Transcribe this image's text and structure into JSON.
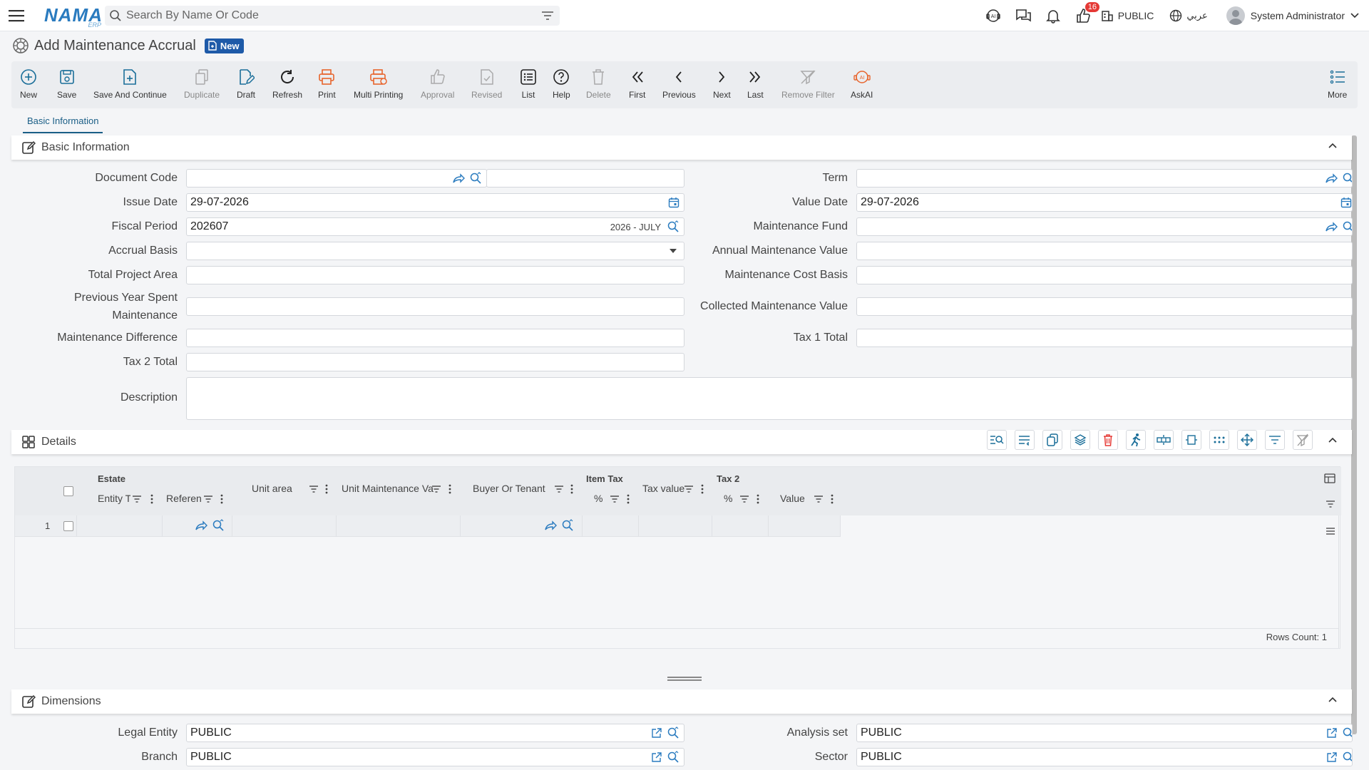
{
  "topbar": {
    "logo_main": "NAMA",
    "logo_sub": "ERP",
    "search_placeholder": "Search By Name Or Code",
    "notif_count": "16",
    "company": "PUBLIC",
    "language": "عربي",
    "user_name": "System Administrator"
  },
  "page": {
    "title": "Add Maintenance Accrual",
    "badge": "New"
  },
  "toolbar": {
    "new": "New",
    "save": "Save",
    "save_continue": "Save And Continue",
    "duplicate": "Duplicate",
    "draft": "Draft",
    "refresh": "Refresh",
    "print": "Print",
    "multi_printing": "Multi Printing",
    "approval": "Approval",
    "revised": "Revised",
    "list": "List",
    "help": "Help",
    "delete": "Delete",
    "first": "First",
    "previous": "Previous",
    "next": "Next",
    "last": "Last",
    "remove_filter": "Remove Filter",
    "askai": "AskAI",
    "more": "More"
  },
  "tabs": {
    "basic": "Basic Information"
  },
  "basic": {
    "title": "Basic Information",
    "labels": {
      "document_code": "Document Code",
      "issue_date": "Issue Date",
      "fiscal_period": "Fiscal Period",
      "accrual_basis": "Accrual Basis",
      "total_project_area": "Total Project Area",
      "prev_year_line1": "Previous Year Spent",
      "prev_year_line2": "Maintenance",
      "maintenance_difference": "Maintenance Difference",
      "tax2_total": "Tax 2 Total",
      "description": "Description",
      "term": "Term",
      "value_date": "Value Date",
      "maintenance_fund": "Maintenance Fund",
      "annual_maintenance_value": "Annual Maintenance Value",
      "maintenance_cost_basis": "Maintenance Cost Basis",
      "collected_maintenance_value": "Collected Maintenance Value",
      "tax1_total": "Tax 1 Total"
    },
    "values": {
      "issue_date": "29-07-2026",
      "value_date": "29-07-2026",
      "fiscal_period": "202607",
      "fiscal_period_suffix": "2026 - JULY"
    }
  },
  "details": {
    "title": "Details",
    "headers": {
      "estate": "Estate",
      "entity_type": "Entity Ty",
      "reference": "Referen",
      "unit_area": "Unit area",
      "unit_maintenance": "Unit Maintenance Va",
      "buyer_tenant": "Buyer Or Tenant",
      "item_tax": "Item Tax",
      "percent1": "%",
      "tax_value": "Tax value",
      "tax2": "Tax 2",
      "percent2": "%",
      "value": "Value"
    },
    "rows": [
      {
        "num": "1"
      }
    ],
    "rows_count": "Rows Count: 1"
  },
  "dimensions": {
    "title": "Dimensions",
    "labels": {
      "legal_entity": "Legal Entity",
      "branch": "Branch",
      "analysis_set": "Analysis set",
      "sector": "Sector"
    },
    "values": {
      "legal_entity": "PUBLIC",
      "branch": "PUBLIC",
      "analysis_set": "PUBLIC",
      "sector": "PUBLIC"
    }
  },
  "colors": {
    "accent": "#1a5e86",
    "badge": "#1e5aa8",
    "print_orange": "#e8642c",
    "notif_red": "#e53935"
  }
}
